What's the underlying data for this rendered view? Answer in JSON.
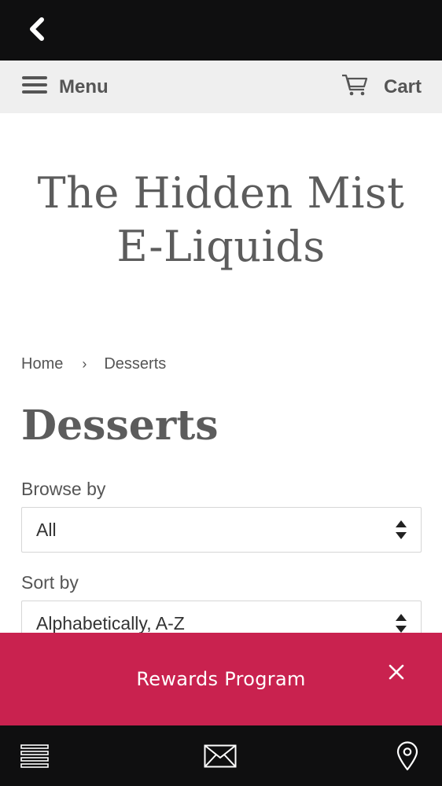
{
  "top_bar": {
    "back_icon": "chevron-left-icon"
  },
  "nav": {
    "menu_label": "Menu",
    "menu_icon": "hamburger-icon",
    "cart_label": "Cart",
    "cart_icon": "cart-icon"
  },
  "site": {
    "title_line1": "The Hidden Mist",
    "title_line2": "E-Liquids"
  },
  "breadcrumb": {
    "home": "Home",
    "separator": "›",
    "current": "Desserts"
  },
  "page": {
    "title": "Desserts"
  },
  "filters": {
    "browse_label": "Browse by",
    "browse_value": "All",
    "sort_label": "Sort by",
    "sort_value": "Alphabetically, A-Z"
  },
  "rewards_banner": {
    "label": "Rewards Program",
    "close_icon": "close-icon",
    "color": "#c9224f"
  },
  "bottom_bar": {
    "icons": [
      "menu-lines-icon",
      "envelope-icon",
      "map-pin-icon"
    ]
  }
}
